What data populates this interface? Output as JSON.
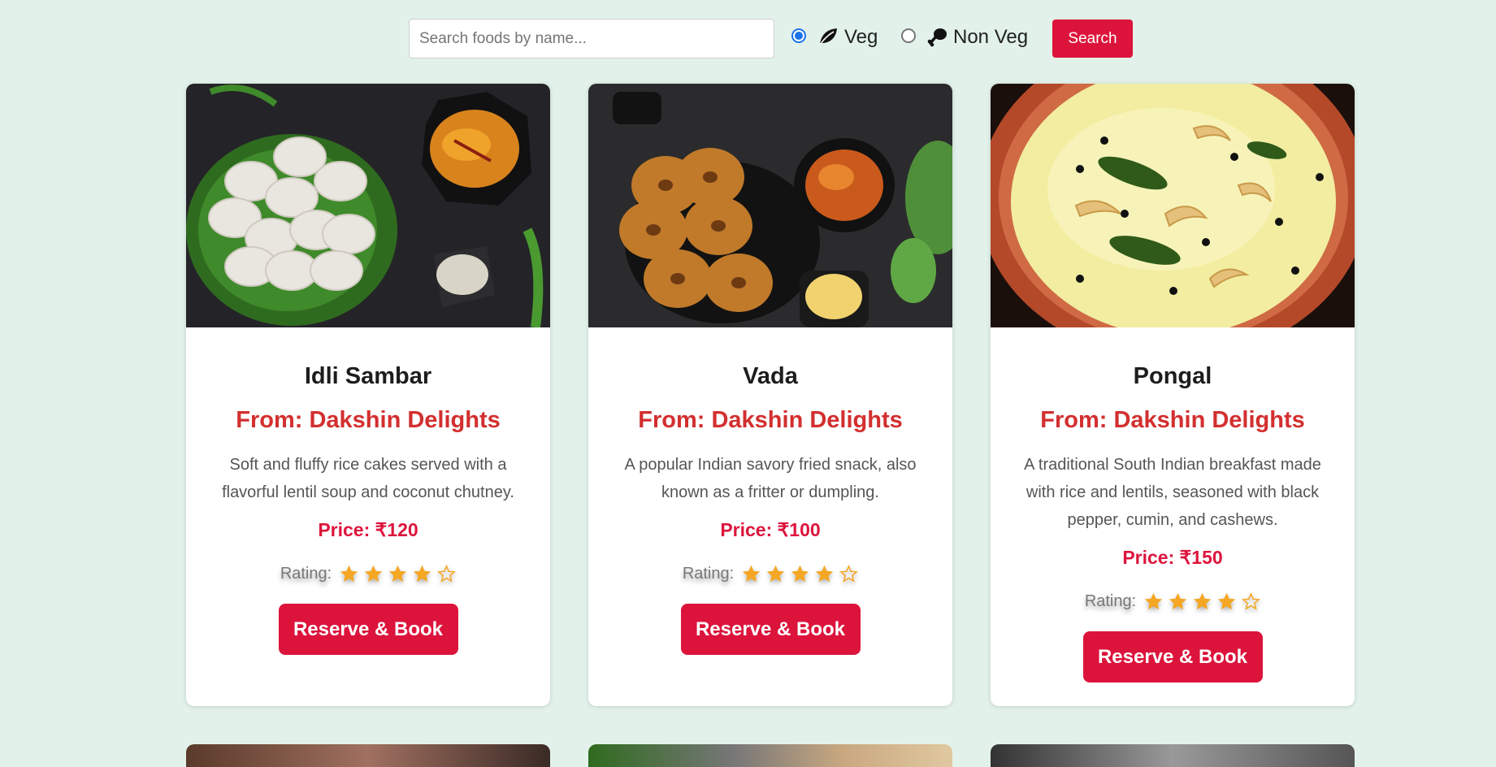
{
  "search": {
    "placeholder": "Search foods by name...",
    "value": "",
    "button_label": "Search"
  },
  "filters": [
    {
      "label": "Veg",
      "checked": true,
      "icon": "leaf-icon"
    },
    {
      "label": "Non Veg",
      "checked": false,
      "icon": "chicken-leg-icon"
    }
  ],
  "colors": {
    "background": "#e2f2ea",
    "accent": "#dc143c",
    "restaurant_text": "#d32f2f",
    "star": "#f5a623"
  },
  "cards": [
    {
      "title": "Idli Sambar",
      "from": "From: Dakshin Delights",
      "description": "Soft and fluffy rice cakes served with a flavorful lentil soup and coconut chutney.",
      "price": "Price: ₹120",
      "rating_label": "Rating:",
      "rating": 4,
      "rating_max": 5,
      "button_label": "Reserve & Book",
      "image": "idli-sambar-photo"
    },
    {
      "title": "Vada",
      "from": "From: Dakshin Delights",
      "description": "A popular Indian savory fried snack, also known as a fritter or dumpling.",
      "price": "Price: ₹100",
      "rating_label": "Rating:",
      "rating": 4,
      "rating_max": 5,
      "button_label": "Reserve & Book",
      "image": "vada-photo"
    },
    {
      "title": "Pongal",
      "from": "From: Dakshin Delights",
      "description": "A traditional South Indian breakfast made with rice and lentils, seasoned with black pepper, cumin, and cashews.",
      "price": "Price: ₹150",
      "rating_label": "Rating:",
      "rating": 4,
      "rating_max": 5,
      "button_label": "Reserve & Book",
      "image": "pongal-photo"
    }
  ]
}
